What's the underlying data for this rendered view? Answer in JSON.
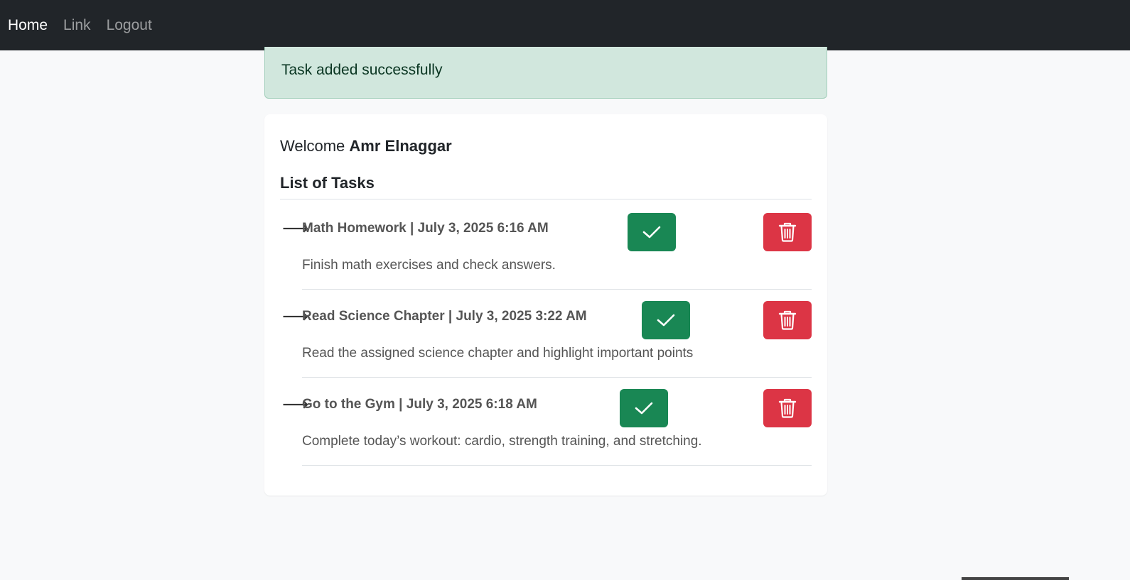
{
  "nav": {
    "items": [
      {
        "label": "Home",
        "active": true
      },
      {
        "label": "Link",
        "active": false
      },
      {
        "label": "Logout",
        "active": false
      }
    ]
  },
  "alert": {
    "message": "Task added successfully"
  },
  "card": {
    "welcome_prefix": "Welcome",
    "user_name": "Amr Elnaggar",
    "list_title": "List of Tasks"
  },
  "tasks": [
    {
      "title": "Math Homework | July 3, 2025 6:16 AM",
      "description": "Finish math exercises and check answers."
    },
    {
      "title": "Read Science Chapter | July 3, 2025 3:22 AM",
      "description": "Read the assigned science chapter and highlight important points"
    },
    {
      "title": "Go to the Gym | July 3, 2025 6:18 AM",
      "description": "Complete today’s workout: cardio, strength training, and stretching."
    }
  ],
  "icons": {
    "bullet": "arrow-right-icon",
    "done": "check-icon",
    "delete": "trash-icon"
  },
  "colors": {
    "navbar": "#212529",
    "success_alert_bg": "#d1e7dd",
    "done_button": "#198754",
    "delete_button": "#dc3545"
  }
}
